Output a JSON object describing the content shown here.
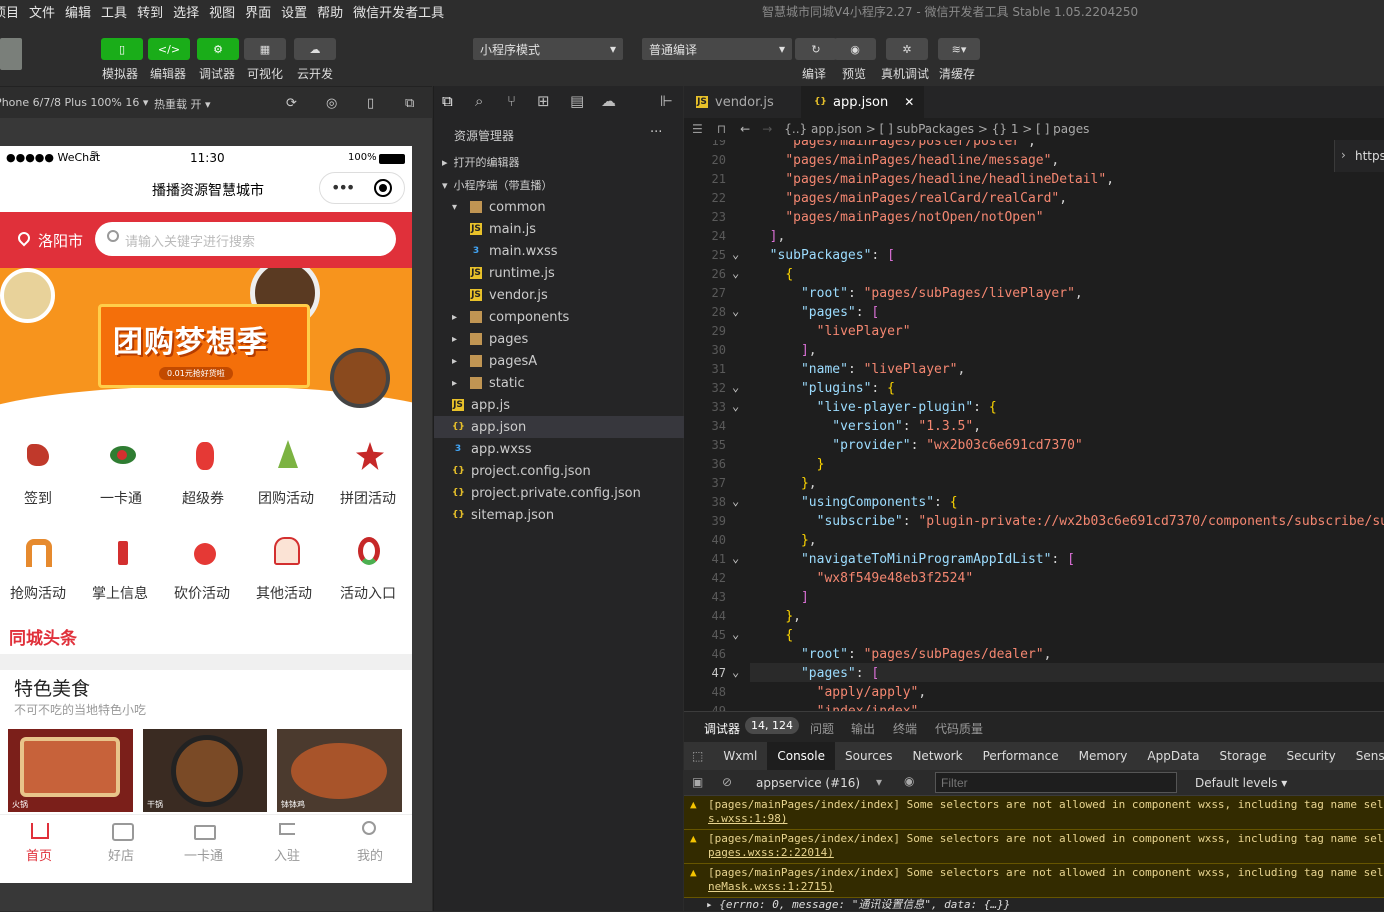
{
  "menubar": {
    "items": [
      "项目",
      "文件",
      "编辑",
      "工具",
      "转到",
      "选择",
      "视图",
      "界面",
      "设置",
      "帮助",
      "微信开发者工具"
    ],
    "window_title": "智慧城市同城V4小程序2.27 - 微信开发者工具 Stable 1.05.2204250"
  },
  "toolbar": {
    "buttons": [
      "模拟器",
      "编辑器",
      "调试器",
      "可视化",
      "云开发"
    ],
    "mode_select": "小程序模式",
    "compile_select": "普通编译",
    "actions": [
      "编译",
      "预览",
      "真机调试",
      "清缓存"
    ]
  },
  "simbar": {
    "device": "iPhone 6/7/8 Plus 100% 16 ▾",
    "hotreload": "热重载 开 ▾"
  },
  "phone": {
    "status": {
      "carrier": "●●●●● WeChat",
      "time": "11:30",
      "battery": "100%"
    },
    "nav_title": "播播资源智慧城市",
    "city": "洛阳市",
    "search_placeholder": "请输入关键字进行搜索",
    "banner_title": "团购梦想季",
    "banner_sub": "0.01元抢好货啦",
    "grid_row1": [
      "签到",
      "一卡通",
      "超级券",
      "团购活动",
      "拼团活动"
    ],
    "grid_row2": [
      "抢购活动",
      "掌上信息",
      "砍价活动",
      "其他活动",
      "活动入口"
    ],
    "headline": "同城头条",
    "food_title": "特色美食",
    "food_sub": "不可不吃的当地特色小吃",
    "food_tags": [
      "火锅",
      "干锅",
      "钵钵鸡"
    ],
    "tabbar": [
      "首页",
      "好店",
      "一卡通",
      "入驻",
      "我的"
    ]
  },
  "explorer": {
    "title": "资源管理器",
    "more": "···",
    "open_editors": "打开的编辑器",
    "project": "小程序端（带直播）",
    "tree": [
      {
        "name": "common",
        "indent": 1,
        "type": "folder-open"
      },
      {
        "name": "main.js",
        "indent": 2,
        "type": "js"
      },
      {
        "name": "main.wxss",
        "indent": 2,
        "type": "wxss"
      },
      {
        "name": "runtime.js",
        "indent": 2,
        "type": "js"
      },
      {
        "name": "vendor.js",
        "indent": 2,
        "type": "js"
      },
      {
        "name": "components",
        "indent": 1,
        "type": "folder"
      },
      {
        "name": "pages",
        "indent": 1,
        "type": "folder"
      },
      {
        "name": "pagesA",
        "indent": 1,
        "type": "folder"
      },
      {
        "name": "static",
        "indent": 1,
        "type": "folder"
      },
      {
        "name": "app.js",
        "indent": 1,
        "type": "js"
      },
      {
        "name": "app.json",
        "indent": 1,
        "type": "json",
        "selected": true
      },
      {
        "name": "app.wxss",
        "indent": 1,
        "type": "wxss"
      },
      {
        "name": "project.config.json",
        "indent": 1,
        "type": "json"
      },
      {
        "name": "project.private.config.json",
        "indent": 1,
        "type": "json"
      },
      {
        "name": "sitemap.json",
        "indent": 1,
        "type": "json"
      }
    ]
  },
  "editor": {
    "tabs": [
      "vendor.js",
      "app.json"
    ],
    "close": "✕",
    "breadcrumb": "{..} app.json > [ ] subPackages > {} 1 > [ ] pages",
    "right_hint": "https",
    "lines": [
      {
        "n": "19",
        "t": "    \"pages/mainPages/poster/poster\","
      },
      {
        "n": "20",
        "t": "    \"pages/mainPages/headline/message\","
      },
      {
        "n": "21",
        "t": "    \"pages/mainPages/headline/headlineDetail\","
      },
      {
        "n": "22",
        "t": "    \"pages/mainPages/realCard/realCard\","
      },
      {
        "n": "23",
        "t": "    \"pages/mainPages/notOpen/notOpen\""
      },
      {
        "n": "24",
        "t": "  ],"
      },
      {
        "n": "25",
        "t": "  \"subPackages\": ["
      },
      {
        "n": "26",
        "t": "    {"
      },
      {
        "n": "27",
        "t": "      \"root\": \"pages/subPages/livePlayer\","
      },
      {
        "n": "28",
        "t": "      \"pages\": ["
      },
      {
        "n": "29",
        "t": "        \"livePlayer\""
      },
      {
        "n": "30",
        "t": "      ],"
      },
      {
        "n": "31",
        "t": "      \"name\": \"livePlayer\","
      },
      {
        "n": "32",
        "t": "      \"plugins\": {"
      },
      {
        "n": "33",
        "t": "        \"live-player-plugin\": {"
      },
      {
        "n": "34",
        "t": "          \"version\": \"1.3.5\","
      },
      {
        "n": "35",
        "t": "          \"provider\": \"wx2b03c6e691cd7370\""
      },
      {
        "n": "36",
        "t": "        }"
      },
      {
        "n": "37",
        "t": "      },"
      },
      {
        "n": "38",
        "t": "      \"usingComponents\": {"
      },
      {
        "n": "39",
        "t": "        \"subscribe\": \"plugin-private://wx2b03c6e691cd7370/components/subscribe/sub"
      },
      {
        "n": "40",
        "t": "      },"
      },
      {
        "n": "41",
        "t": "      \"navigateToMiniProgramAppIdList\": ["
      },
      {
        "n": "42",
        "t": "        \"wx8f549e48eb3f2524\""
      },
      {
        "n": "43",
        "t": "      ]"
      },
      {
        "n": "44",
        "t": "    },"
      },
      {
        "n": "45",
        "t": "    {"
      },
      {
        "n": "46",
        "t": "      \"root\": \"pages/subPages/dealer\","
      },
      {
        "n": "47",
        "t": "      \"pages\": ["
      },
      {
        "n": "48",
        "t": "        \"apply/apply\","
      },
      {
        "n": "49",
        "t": "        \"index/index\","
      }
    ]
  },
  "panel": {
    "tabs": [
      "调试器",
      "问题",
      "输出",
      "终端",
      "代码质量"
    ],
    "badge": "14, 124",
    "devtools": [
      "Wxml",
      "Console",
      "Sources",
      "Network",
      "Performance",
      "Memory",
      "AppData",
      "Storage",
      "Security",
      "Sens"
    ],
    "context": "appservice (#16)",
    "filter_placeholder": "Filter",
    "levels": "Default levels ▾",
    "warnings": [
      {
        "msg": "[pages/mainPages/index/index] Some selectors are not allowed in component wxss, including tag name sele",
        "src": "s.wxss:1:98)"
      },
      {
        "msg": "[pages/mainPages/index/index] Some selectors are not allowed in component wxss, including tag name sele",
        "src": "pages.wxss:2:22014)"
      },
      {
        "msg": "[pages/mainPages/index/index] Some selectors are not allowed in component wxss, including tag name sele",
        "src": "neMask.wxss:1:2715)"
      }
    ],
    "log": "▸ {errno: 0, message: \"通讯设置信息\", data: {…}}"
  },
  "colors": {
    "accent_green": "#1aad19",
    "brand_red": "#e0303a",
    "banner_orange": "#f7941d"
  }
}
